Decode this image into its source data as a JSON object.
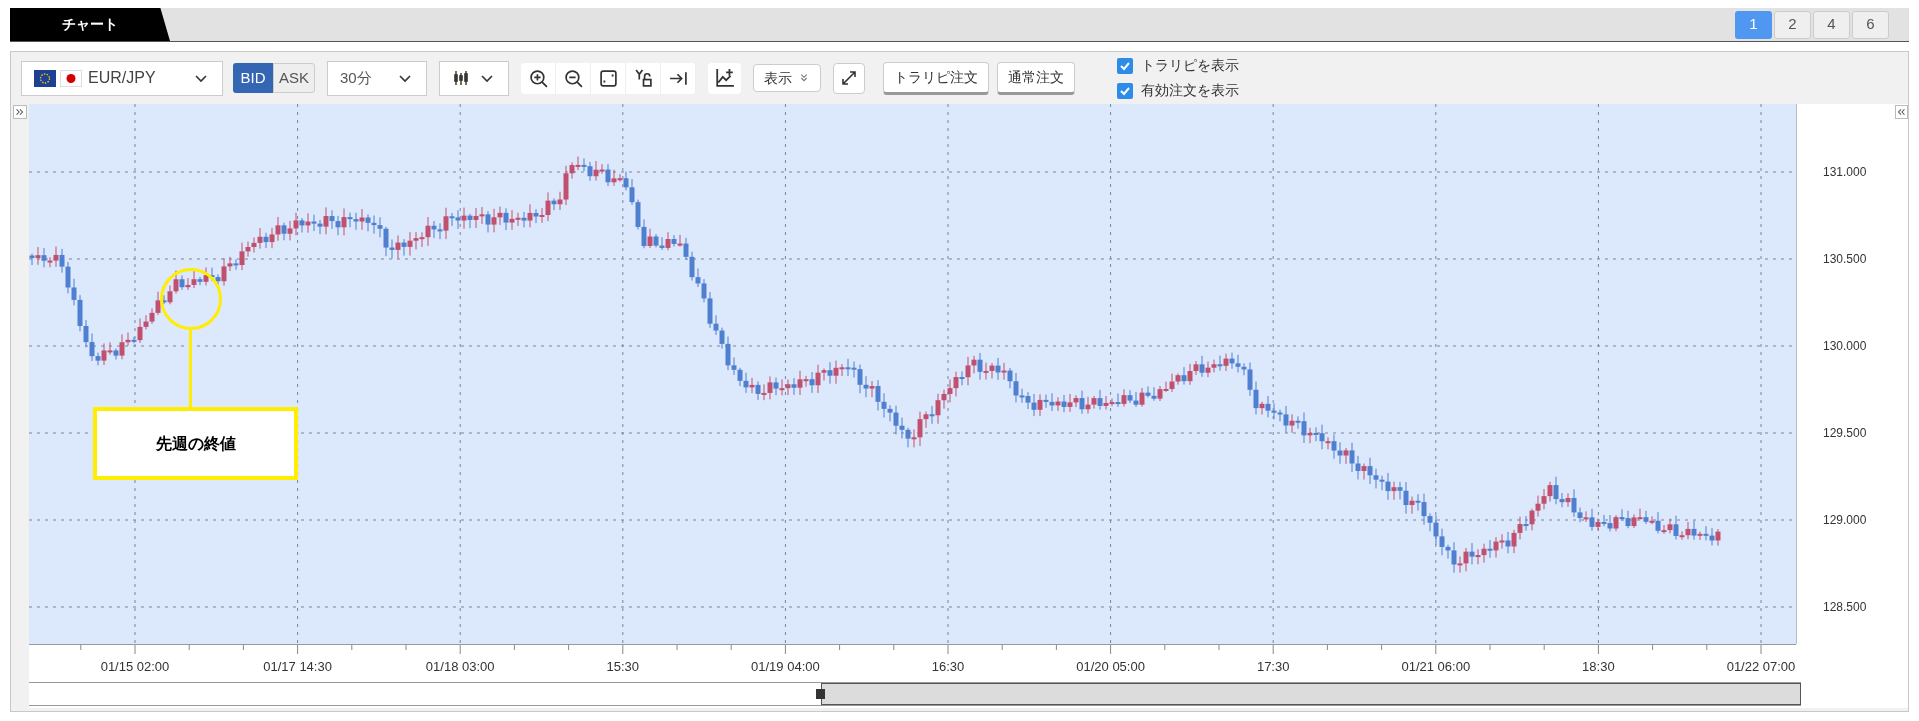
{
  "tab_bar": {
    "tabs": [
      {
        "label": "チャート",
        "selected": true
      }
    ],
    "layout_buttons": [
      {
        "label": "1",
        "selected": true
      },
      {
        "label": "2",
        "selected": false
      },
      {
        "label": "4",
        "selected": false
      },
      {
        "label": "6",
        "selected": false
      }
    ]
  },
  "toolbar": {
    "symbol": "EUR/JPY",
    "price_sides": [
      {
        "label": "BID",
        "selected": true
      },
      {
        "label": "ASK",
        "selected": false
      }
    ],
    "timeframe": "30分",
    "display_button": "表示",
    "order_buttons": [
      "トラリピ注文",
      "通常注文"
    ],
    "checkboxes": [
      {
        "label": "トラリピを表示",
        "checked": true
      },
      {
        "label": "有効注文を表示",
        "checked": true
      }
    ]
  },
  "chart": {
    "y_axis_labels": [
      "131.000",
      "130.500",
      "130.000",
      "129.500",
      "129.000",
      "128.500"
    ],
    "x_axis_labels": [
      "01/15 02:00",
      "01/17 14:30",
      "01/18 03:00",
      "15:30",
      "01/19 04:00",
      "16:30",
      "01/20 05:00",
      "17:30",
      "01/21 06:00",
      "18:30",
      "01/22 07:00"
    ],
    "annotation": "先週の終値"
  }
}
